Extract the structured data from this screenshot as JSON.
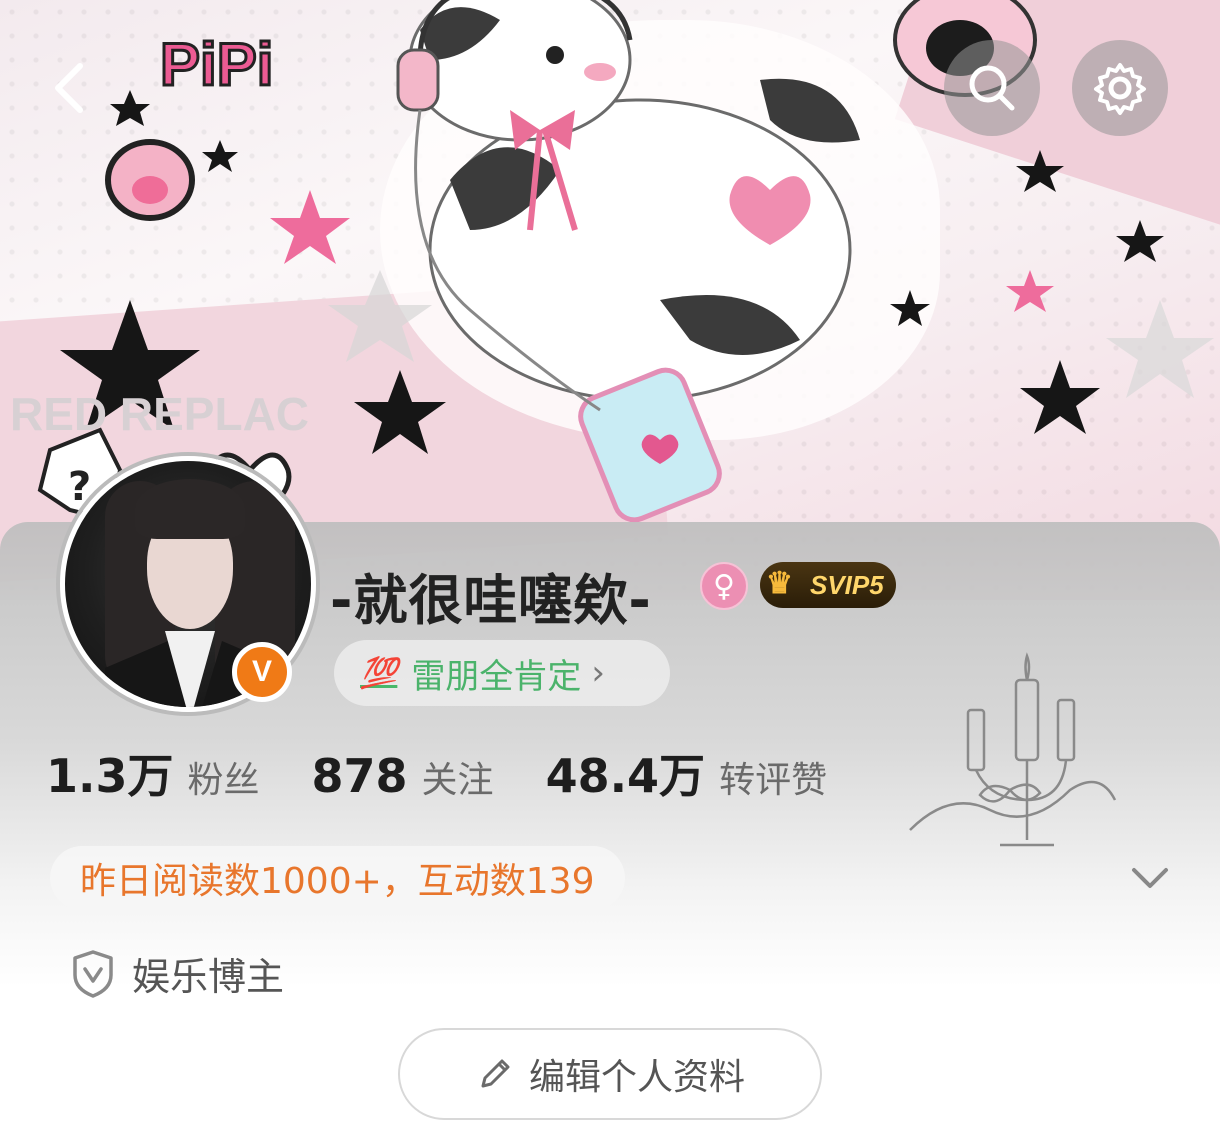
{
  "header": {
    "back_icon": "back-arrow-icon",
    "search_icon": "search-icon",
    "settings_icon": "gear-icon"
  },
  "banner": {
    "sticker_text_logo": "PiPi",
    "scribble_text": "RED REPLAC"
  },
  "profile": {
    "name": "-就很哇噻欸-",
    "gender": "female",
    "gender_symbol": "♀",
    "svip_label": "SVIP5",
    "verified_mark": "V",
    "tag_icon": "💯",
    "tag_text": "雷朋全肯定",
    "tag_chevron": "›"
  },
  "stats": [
    {
      "value": "1.3万",
      "label": "粉丝"
    },
    {
      "value": "878",
      "label": "关注"
    },
    {
      "value": "48.4万",
      "label": "转评赞"
    }
  ],
  "reads_summary": "昨日阅读数1000+，互动数139",
  "role_label": "娱乐博主",
  "edit_button_label": "编辑个人资料",
  "colors": {
    "accent_orange": "#e8762c",
    "verified_orange": "#f07a16",
    "tag_green": "#4bb36b",
    "gender_pink": "#ec8fb3"
  }
}
